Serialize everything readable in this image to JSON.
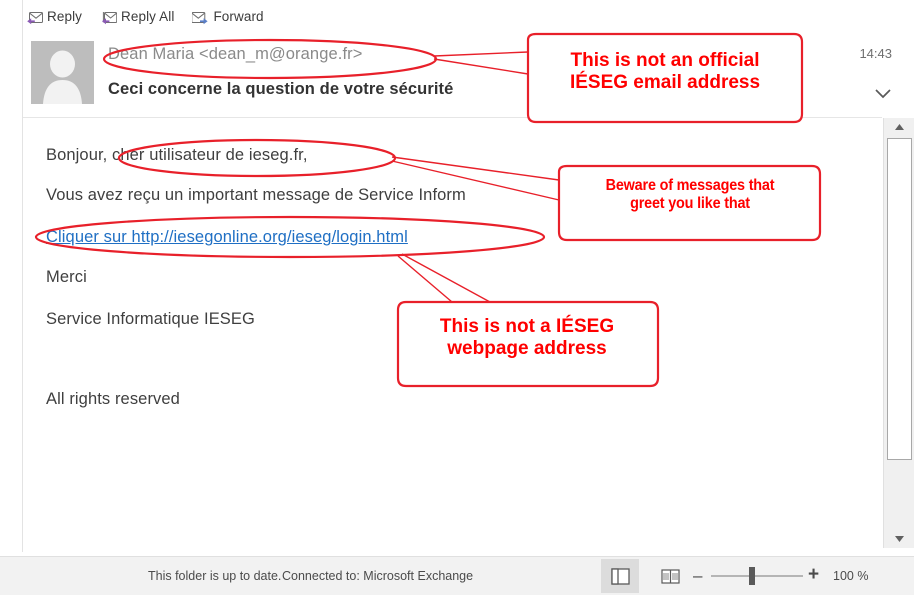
{
  "app": {
    "name": "Microsoft Outlook reading pane"
  },
  "toolbar": {
    "reply_label": "Reply",
    "reply_all_label": "Reply All",
    "forward_label": "Forward",
    "reply_icon": "reply-envelope-icon",
    "reply_all_icon": "reply-all-envelope-icon",
    "forward_icon": "forward-envelope-icon"
  },
  "message": {
    "avatar_icon": "contact-placeholder-icon",
    "from": "Dean Maria <dean_m@orange.fr>",
    "subject": "Ceci concerne la question de votre sécurité",
    "time": "14:43",
    "expand_icon": "chevron-down-icon",
    "body": {
      "greeting": "Bonjour, cher utilisateur de ieseg.fr,",
      "line2": "Vous avez reçu un important message de Service Inform",
      "link": "Cliquer sur http://iesegonline.org/ieseg/login.html",
      "thanks": "Merci",
      "signature": "Service Informatique IESEG",
      "rights": "All rights reserved"
    }
  },
  "scrollbar": {
    "up_icon": "scroll-up-arrow-icon",
    "down_icon": "scroll-down-arrow-icon"
  },
  "statusbar": {
    "folder_status": "This folder is up to date.",
    "connection_status": "Connected to: Microsoft Exchange",
    "normal_view_icon": "normal-view-icon",
    "reading_view_icon": "reading-view-icon",
    "zoom_out_label": "–",
    "zoom_in_label": "+",
    "zoom_value": "100 %"
  },
  "annotations": {
    "accent_color": "#ff0000",
    "callout_1": "This is not an official\nIÉSEG email address",
    "callout_2": "Beware of messages that\ngreet you like that",
    "callout_3": "This is not a IÉSEG\nwebpage address"
  },
  "colors": {
    "link": "#1f6fc4",
    "sender_text": "#8a8a8a",
    "body_text": "#3f3f3f",
    "annotation_red": "#ff0000",
    "avatar_bg": "#bdbdbd"
  }
}
